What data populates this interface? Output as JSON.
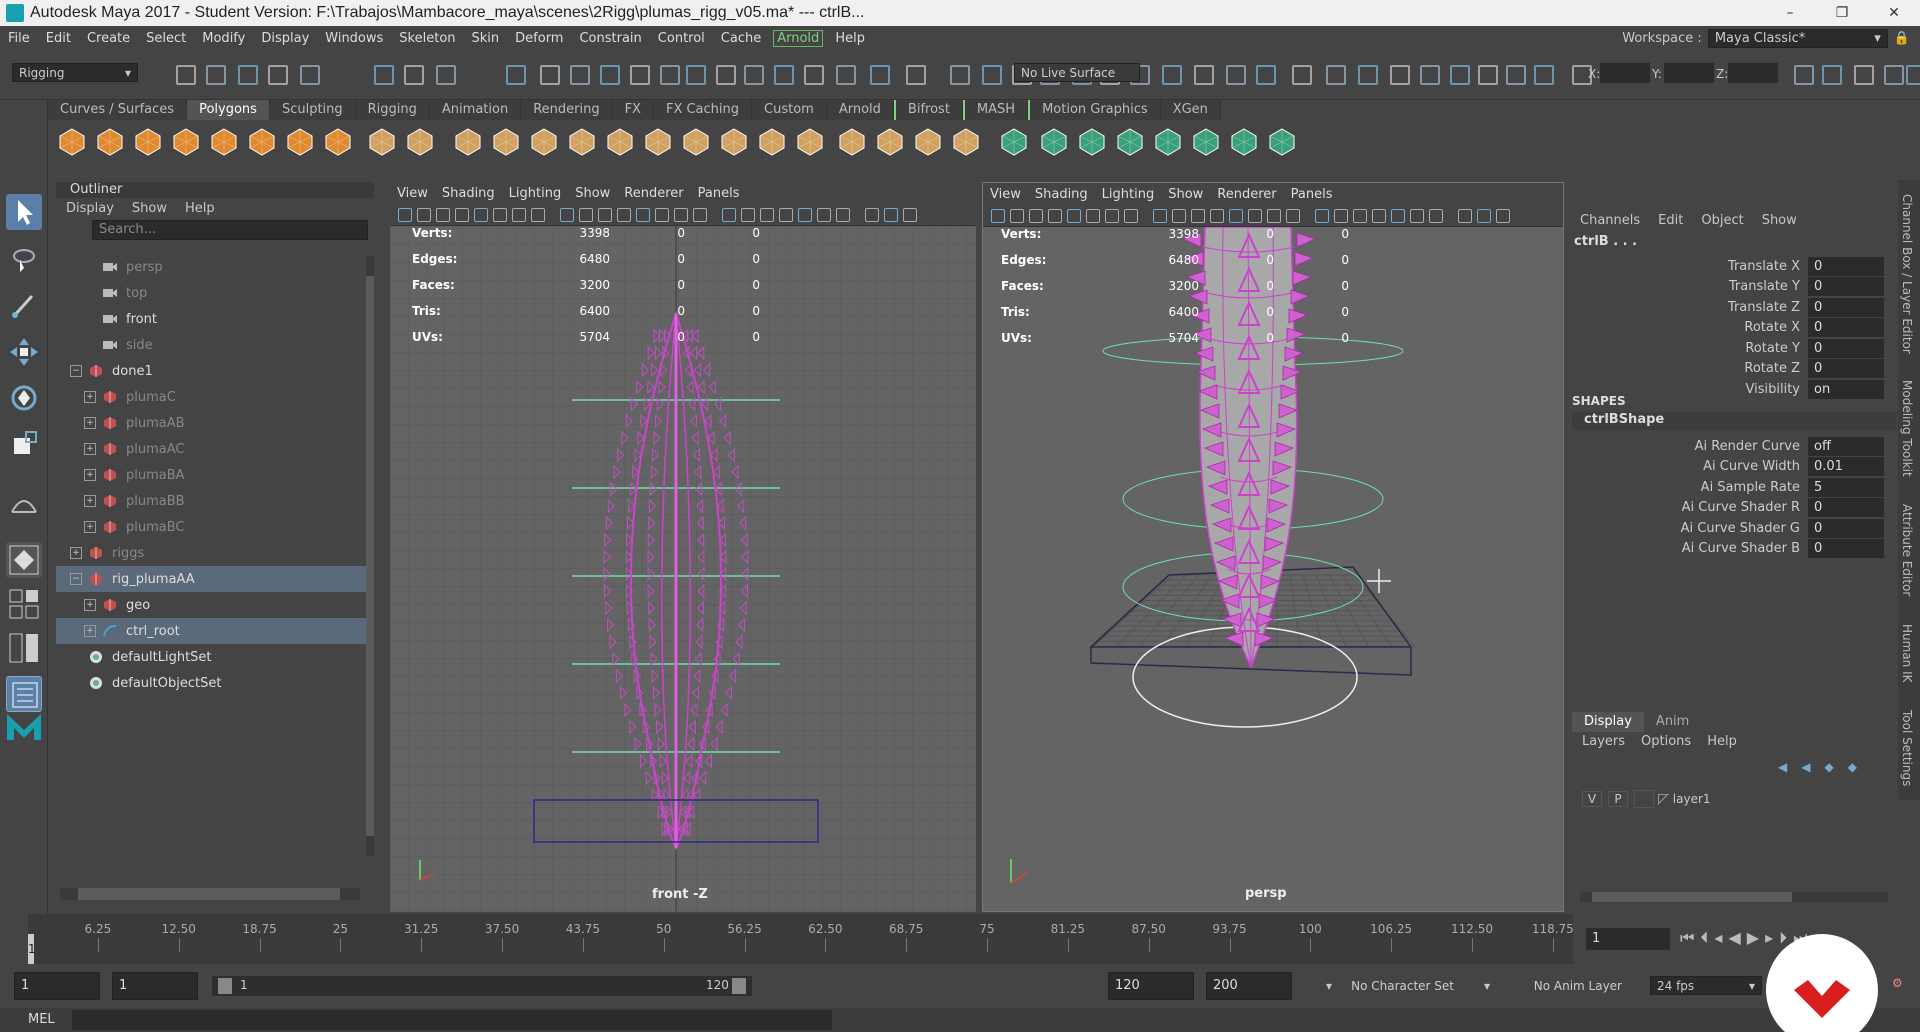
{
  "title_bar": {
    "title": "Autodesk Maya 2017 - Student Version: F:\\Trabajos\\Mambacore_maya\\scenes\\2Rigg\\plumas_rigg_v05.ma*   ---   ctrlB...",
    "minimize": "–",
    "maximize": "❐",
    "close": "✕"
  },
  "menu": [
    "File",
    "Edit",
    "Create",
    "Select",
    "Modify",
    "Display",
    "Windows",
    "Skeleton",
    "Skin",
    "Deform",
    "Constrain",
    "Control",
    "Cache",
    "Arnold",
    "Help"
  ],
  "workspace": {
    "label": "Workspace :",
    "value": "Maya Classic*"
  },
  "status_line": {
    "menuset": "Rigging",
    "live_surface": "No Live Surface",
    "x_label": "X:",
    "y_label": "Y:",
    "z_label": "Z:"
  },
  "shelf_tabs": [
    "Curves / Surfaces",
    "Polygons",
    "Sculpting",
    "Rigging",
    "Animation",
    "Rendering",
    "FX",
    "FX Caching",
    "Custom",
    "Arnold",
    "Bifrost",
    "MASH",
    "Motion Graphics",
    "XGen"
  ],
  "shelf_active": "Polygons",
  "shelf_icons": [
    "poly-sphere-icon",
    "poly-cube-icon",
    "poly-cylinder-icon",
    "poly-cone-icon",
    "poly-plane-icon",
    "poly-torus-icon",
    "poly-pyramid-icon",
    "poly-pipe-icon",
    "text-icon",
    "svg-icon",
    "combine-icon",
    "separate-icon",
    "extract-icon",
    "smooth-icon",
    "boolean-icon",
    "mirror-icon",
    "bridge-icon",
    "extrude-icon",
    "bevel-icon",
    "append-icon",
    "fill-hole-icon",
    "multi-cut-icon",
    "target-weld-icon",
    "quad-draw-icon",
    "uv-editor-icon",
    "planar-map-icon",
    "auto-map-icon",
    "cylindrical-map-icon",
    "spherical-map-icon",
    "uv-layout-icon",
    "cut-uv-icon",
    "sew-uv-icon"
  ],
  "outliner": {
    "title": "Outliner",
    "menus": [
      "Display",
      "Show",
      "Help"
    ],
    "search_placeholder": "Search...",
    "items": [
      {
        "label": "persp",
        "indent": 1,
        "dim": true,
        "type": "camera"
      },
      {
        "label": "top",
        "indent": 1,
        "dim": true,
        "type": "camera"
      },
      {
        "label": "front",
        "indent": 1,
        "dim": false,
        "type": "camera"
      },
      {
        "label": "side",
        "indent": 1,
        "dim": true,
        "type": "camera"
      },
      {
        "label": "done1",
        "indent": 0,
        "dim": false,
        "type": "group",
        "expand": "-"
      },
      {
        "label": "plumaC",
        "indent": 1,
        "dim": true,
        "type": "mesh",
        "expand": "+"
      },
      {
        "label": "plumaAB",
        "indent": 1,
        "dim": true,
        "type": "mesh",
        "expand": "+"
      },
      {
        "label": "plumaAC",
        "indent": 1,
        "dim": true,
        "type": "mesh",
        "expand": "+"
      },
      {
        "label": "plumaBA",
        "indent": 1,
        "dim": true,
        "type": "mesh",
        "expand": "+"
      },
      {
        "label": "plumaBB",
        "indent": 1,
        "dim": true,
        "type": "mesh",
        "expand": "+"
      },
      {
        "label": "plumaBC",
        "indent": 1,
        "dim": true,
        "type": "mesh",
        "expand": "+"
      },
      {
        "label": "riggs",
        "indent": 0,
        "dim": true,
        "type": "group",
        "expand": "+"
      },
      {
        "label": "rig_plumaAA",
        "indent": 0,
        "dim": false,
        "type": "group",
        "expand": "-",
        "selected": true
      },
      {
        "label": "geo",
        "indent": 1,
        "dim": false,
        "type": "mesh",
        "expand": "+"
      },
      {
        "label": "ctrl_root",
        "indent": 1,
        "dim": false,
        "type": "curve",
        "expand": "+",
        "selected": true
      },
      {
        "label": "defaultLightSet",
        "indent": 0,
        "dim": false,
        "type": "set"
      },
      {
        "label": "defaultObjectSet",
        "indent": 0,
        "dim": false,
        "type": "set"
      }
    ]
  },
  "viewport_menus": [
    "View",
    "Shading",
    "Lighting",
    "Show",
    "Renderer",
    "Panels"
  ],
  "viewport_left": {
    "label": "front -Z",
    "hud": [
      {
        "k": "Verts:",
        "a": "3398",
        "b": "0",
        "c": "0"
      },
      {
        "k": "Edges:",
        "a": "6480",
        "b": "0",
        "c": "0"
      },
      {
        "k": "Faces:",
        "a": "3200",
        "b": "0",
        "c": "0"
      },
      {
        "k": "Tris:",
        "a": "6400",
        "b": "0",
        "c": "0"
      },
      {
        "k": "UVs:",
        "a": "5704",
        "b": "0",
        "c": "0"
      }
    ]
  },
  "viewport_right": {
    "label": "persp",
    "hud": [
      {
        "k": "Verts:",
        "a": "3398",
        "b": "0",
        "c": "0"
      },
      {
        "k": "Edges:",
        "a": "6480",
        "b": "0",
        "c": "0"
      },
      {
        "k": "Faces:",
        "a": "3200",
        "b": "0",
        "c": "0"
      },
      {
        "k": "Tris:",
        "a": "6400",
        "b": "0",
        "c": "0"
      },
      {
        "k": "UVs:",
        "a": "5704",
        "b": "0",
        "c": "0"
      }
    ]
  },
  "channel_box": {
    "menus": [
      "Channels",
      "Edit",
      "Object",
      "Show"
    ],
    "object": "ctrlB . . .",
    "channels": [
      {
        "name": "Translate X",
        "value": "0"
      },
      {
        "name": "Translate Y",
        "value": "0"
      },
      {
        "name": "Translate Z",
        "value": "0"
      },
      {
        "name": "Rotate X",
        "value": "0"
      },
      {
        "name": "Rotate Y",
        "value": "0"
      },
      {
        "name": "Rotate Z",
        "value": "0"
      },
      {
        "name": "Visibility",
        "value": "on"
      }
    ],
    "shapes_header": "SHAPES",
    "shape_name": "ctrlBShape",
    "shape_channels": [
      {
        "name": "Ai Render Curve",
        "value": "off"
      },
      {
        "name": "Ai Curve Width",
        "value": "0.01"
      },
      {
        "name": "Ai Sample Rate",
        "value": "5"
      },
      {
        "name": "Ai Curve Shader R",
        "value": "0"
      },
      {
        "name": "Ai Curve Shader G",
        "value": "0"
      },
      {
        "name": "Ai Curve Shader B",
        "value": "0"
      }
    ]
  },
  "layer_editor": {
    "tabs": [
      "Display",
      "Anim"
    ],
    "menus": [
      "Layers",
      "Options",
      "Help"
    ],
    "layer": {
      "v": "V",
      "p": "P",
      "name": "layer1"
    }
  },
  "side_tabs": [
    "Channel Box / Layer Editor",
    "Modeling Toolkit",
    "Attribute Editor",
    "Human IK",
    "Tool Settings"
  ],
  "time_slider": {
    "ticks": [
      "1",
      "6.25",
      "12.50",
      "18.75",
      "25",
      "31.25",
      "37.50",
      "43.75",
      "50",
      "56.25",
      "62.50",
      "68.75",
      "75",
      "81.25",
      "87.50",
      "93.75",
      "100",
      "106.25",
      "112.50",
      "118.75"
    ],
    "current_frame": "1",
    "range_min": 1,
    "range_max": 120
  },
  "range_slider": {
    "start": "1",
    "inner_start": "1",
    "bar_start": "1",
    "bar_end": "120",
    "end": "120",
    "anim_end": "200",
    "character_set": "No Character Set",
    "anim_layer": "No Anim Layer",
    "fps": "24 fps"
  },
  "command_line": {
    "label": "MEL"
  },
  "colors": {
    "mesh_selected": "#d040d0",
    "ctrl_curve": "#6ee0a8",
    "grid": "#585858",
    "selection_highlight": "#5a6a7a",
    "arnold_green": "#7ed17e"
  }
}
